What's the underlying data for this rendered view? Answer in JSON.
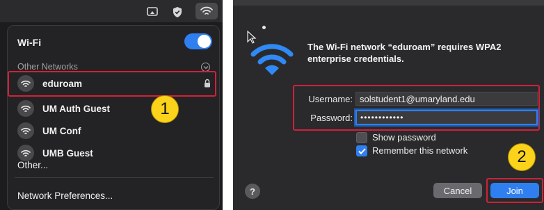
{
  "left_panel": {
    "menubar_icons": [
      "screen-mirroring-icon",
      "shield-icon",
      "wifi-icon"
    ],
    "menu": {
      "title": "Wi-Fi",
      "wifi_enabled": true,
      "section_label": "Other Networks",
      "networks": [
        {
          "name": "eduroam",
          "secured": true
        },
        {
          "name": "UM Auth Guest",
          "secured": false
        },
        {
          "name": "UM Conf",
          "secured": false
        },
        {
          "name": "UMB Guest",
          "secured": false
        }
      ],
      "other_label": "Other...",
      "prefs_label": "Network Preferences..."
    },
    "step_badge": "1"
  },
  "dialog": {
    "message": "The Wi-Fi network “eduroam” requires WPA2 enterprise credentials.",
    "username_label": "Username:",
    "username_value": "solstudent1@umaryland.edu",
    "password_label": "Password:",
    "password_value": "••••••••••••",
    "show_password_label": "Show password",
    "show_password_checked": false,
    "remember_label": "Remember this network",
    "remember_checked": true,
    "help_label": "?",
    "cancel_label": "Cancel",
    "join_label": "Join",
    "step_badge": "2"
  },
  "colors": {
    "accent_blue": "#2f7ff0",
    "highlight_red": "#d0213b",
    "badge_yellow": "#fbd31a"
  }
}
